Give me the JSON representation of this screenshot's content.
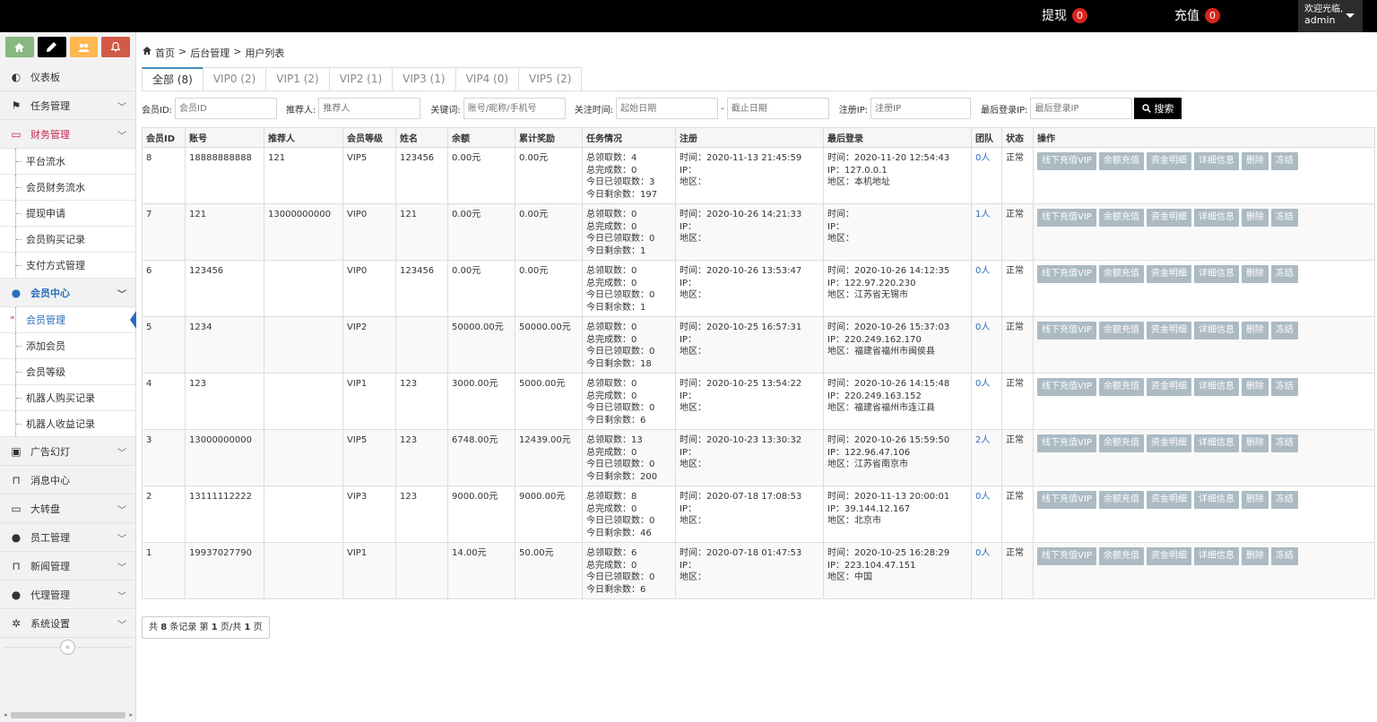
{
  "topbar": {
    "withdraw_label": "提现",
    "withdraw_count": "0",
    "recharge_label": "充值",
    "recharge_count": "0",
    "welcome": "欢迎光临,",
    "username": "admin"
  },
  "sidebar": {
    "dashboard": "仪表板",
    "task_mgmt": "任务管理",
    "finance_mgmt": "财务管理",
    "finance_subs": [
      "平台流水",
      "会员财务流水",
      "提现申请",
      "会员购买记录",
      "支付方式管理"
    ],
    "member_center": "会员中心",
    "member_subs": [
      "会员管理",
      "添加会员",
      "会员等级",
      "机器人购买记录",
      "机器人收益记录"
    ],
    "ads": "广告幻灯",
    "messages": "消息中心",
    "wheel": "大转盘",
    "staff": "员工管理",
    "news": "新闻管理",
    "agents": "代理管理",
    "settings": "系统设置"
  },
  "breadcrumb": {
    "home": "首页",
    "sep1": ">",
    "admin": "后台管理",
    "sep2": ">",
    "current": "用户列表"
  },
  "tabs": [
    "全部 (8)",
    "VIP0 (2)",
    "VIP1 (2)",
    "VIP2 (1)",
    "VIP3 (1)",
    "VIP4 (0)",
    "VIP5 (2)"
  ],
  "filters": {
    "member_id_label": "会员ID:",
    "member_id_placeholder": "会员ID",
    "referrer_label": "推荐人:",
    "referrer_placeholder": "推荐人",
    "keyword_label": "关键词:",
    "keyword_placeholder": "账号/昵称/手机号",
    "follow_time_label": "关注时间:",
    "start_date_placeholder": "起始日期",
    "date_sep": "-",
    "end_date_placeholder": "截止日期",
    "reg_ip_label": "注册IP:",
    "reg_ip_placeholder": "注册IP",
    "last_ip_label": "最后登录IP:",
    "last_ip_placeholder": "最后登录IP",
    "search_label": "搜索"
  },
  "table": {
    "headers": [
      "会员ID",
      "账号",
      "推荐人",
      "会员等级",
      "姓名",
      "余额",
      "累计奖励",
      "任务情况",
      "注册",
      "最后登录",
      "团队",
      "状态",
      "操作"
    ],
    "ops": [
      "线下充值VIP",
      "余额充值",
      "资金明细",
      "详细信息",
      "删除",
      "冻结"
    ],
    "rows": [
      {
        "id": "8",
        "account": "18888888888",
        "referrer": "121",
        "level": "VIP5",
        "name": "123456",
        "balance": "0.00元",
        "reward": "0.00元",
        "task": [
          "总领取数：4",
          "总完成数：0",
          "今日已领取数：3",
          "今日剩余数：197"
        ],
        "reg": [
          "时间：2020-11-13 21:45:59",
          "IP：",
          "地区："
        ],
        "last": [
          "时间：2020-11-20 12:54:43",
          "IP：127.0.0.1",
          "地区：本机地址"
        ],
        "team": "0人",
        "status": "正常"
      },
      {
        "id": "7",
        "account": "121",
        "referrer": "13000000000",
        "level": "VIP0",
        "name": "121",
        "balance": "0.00元",
        "reward": "0.00元",
        "task": [
          "总领取数：0",
          "总完成数：0",
          "今日已领取数：0",
          "今日剩余数：1"
        ],
        "reg": [
          "时间：2020-10-26 14:21:33",
          "IP：",
          "地区："
        ],
        "last": [
          "时间：",
          "IP：",
          "地区："
        ],
        "team": "1人",
        "status": "正常"
      },
      {
        "id": "6",
        "account": "123456",
        "referrer": "",
        "level": "VIP0",
        "name": "123456",
        "balance": "0.00元",
        "reward": "0.00元",
        "task": [
          "总领取数：0",
          "总完成数：0",
          "今日已领取数：0",
          "今日剩余数：1"
        ],
        "reg": [
          "时间：2020-10-26 13:53:47",
          "IP：",
          "地区："
        ],
        "last": [
          "时间：2020-10-26 14:12:35",
          "IP：122.97.220.230",
          "地区：江苏省无锡市"
        ],
        "team": "0人",
        "status": "正常"
      },
      {
        "id": "5",
        "account": "1234",
        "referrer": "",
        "level": "VIP2",
        "name": "",
        "balance": "50000.00元",
        "reward": "50000.00元",
        "task": [
          "总领取数：0",
          "总完成数：0",
          "今日已领取数：0",
          "今日剩余数：18"
        ],
        "reg": [
          "时间：2020-10-25 16:57:31",
          "IP：",
          "地区："
        ],
        "last": [
          "时间：2020-10-26 15:37:03",
          "IP：220.249.162.170",
          "地区：福建省福州市闽侯县"
        ],
        "team": "0人",
        "status": "正常"
      },
      {
        "id": "4",
        "account": "123",
        "referrer": "",
        "level": "VIP1",
        "name": "123",
        "balance": "3000.00元",
        "reward": "5000.00元",
        "task": [
          "总领取数：0",
          "总完成数：0",
          "今日已领取数：0",
          "今日剩余数：6"
        ],
        "reg": [
          "时间：2020-10-25 13:54:22",
          "IP：",
          "地区："
        ],
        "last": [
          "时间：2020-10-26 14:15:48",
          "IP：220.249.163.152",
          "地区：福建省福州市连江县"
        ],
        "team": "0人",
        "status": "正常"
      },
      {
        "id": "3",
        "account": "13000000000",
        "referrer": "",
        "level": "VIP5",
        "name": "123",
        "balance": "6748.00元",
        "reward": "12439.00元",
        "task": [
          "总领取数：13",
          "总完成数：0",
          "今日已领取数：0",
          "今日剩余数：200"
        ],
        "reg": [
          "时间：2020-10-23 13:30:32",
          "IP：",
          "地区："
        ],
        "last": [
          "时间：2020-10-26 15:59:50",
          "IP：122.96.47.106",
          "地区：江苏省南京市"
        ],
        "team": "2人",
        "status": "正常"
      },
      {
        "id": "2",
        "account": "13111112222",
        "referrer": "",
        "level": "VIP3",
        "name": "123",
        "balance": "9000.00元",
        "reward": "9000.00元",
        "task": [
          "总领取数：8",
          "总完成数：0",
          "今日已领取数：0",
          "今日剩余数：46"
        ],
        "reg": [
          "时间：2020-07-18 17:08:53",
          "IP：",
          "地区："
        ],
        "last": [
          "时间：2020-11-13 20:00:01",
          "IP：39.144.12.167",
          "地区：北京市"
        ],
        "team": "0人",
        "status": "正常"
      },
      {
        "id": "1",
        "account": "19937027790",
        "referrer": "",
        "level": "VIP1",
        "name": "",
        "balance": "14.00元",
        "reward": "50.00元",
        "task": [
          "总领取数：6",
          "总完成数：0",
          "今日已领取数：0",
          "今日剩余数：6"
        ],
        "reg": [
          "时间：2020-07-18 01:47:53",
          "IP：",
          "地区："
        ],
        "last": [
          "时间：2020-10-25 16:28:29",
          "IP：223.104.47.151",
          "地区：中国"
        ],
        "team": "0人",
        "status": "正常"
      }
    ]
  },
  "pager": {
    "prefix": "共",
    "total": "8",
    "mid1": "条记录 第",
    "page": "1",
    "mid2": "页/共",
    "pages": "1",
    "suffix": "页"
  },
  "colors": {
    "topbar": "#000000",
    "badge": "#d9251c",
    "accent_blue": "#2a6ebb",
    "active_red": "#c7254e",
    "op_button": "#abbac3",
    "sb_btn_home": "#87b87f",
    "sb_btn_edit": "#000000",
    "sb_btn_users": "#ffb752",
    "sb_btn_bell": "#d15b47"
  }
}
